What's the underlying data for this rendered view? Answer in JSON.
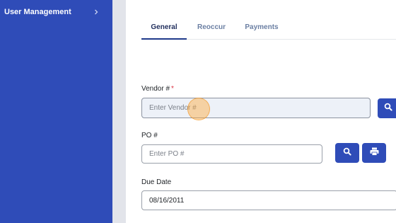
{
  "sidebar": {
    "items": [
      {
        "label": "User Management",
        "icon": "chevron-right-icon"
      }
    ],
    "background": "#2f4cb8"
  },
  "tabs": [
    {
      "label": "General",
      "active": true
    },
    {
      "label": "Reoccur",
      "active": false
    },
    {
      "label": "Payments",
      "active": false
    }
  ],
  "form": {
    "vendor": {
      "label": "Vendor #",
      "required_mark": "*",
      "placeholder": "Enter Vendor #",
      "value": "",
      "button_icon": "search-icon"
    },
    "po": {
      "label": "PO #",
      "placeholder": "Enter PO #",
      "value": "",
      "buttons": [
        "search-icon",
        "print-icon"
      ]
    },
    "due_date": {
      "label": "Due Date",
      "value": "08/16/2011"
    }
  },
  "colors": {
    "accent": "#2f4cb8",
    "active_tab": "#1f3a8a",
    "required": "#dc3545"
  }
}
